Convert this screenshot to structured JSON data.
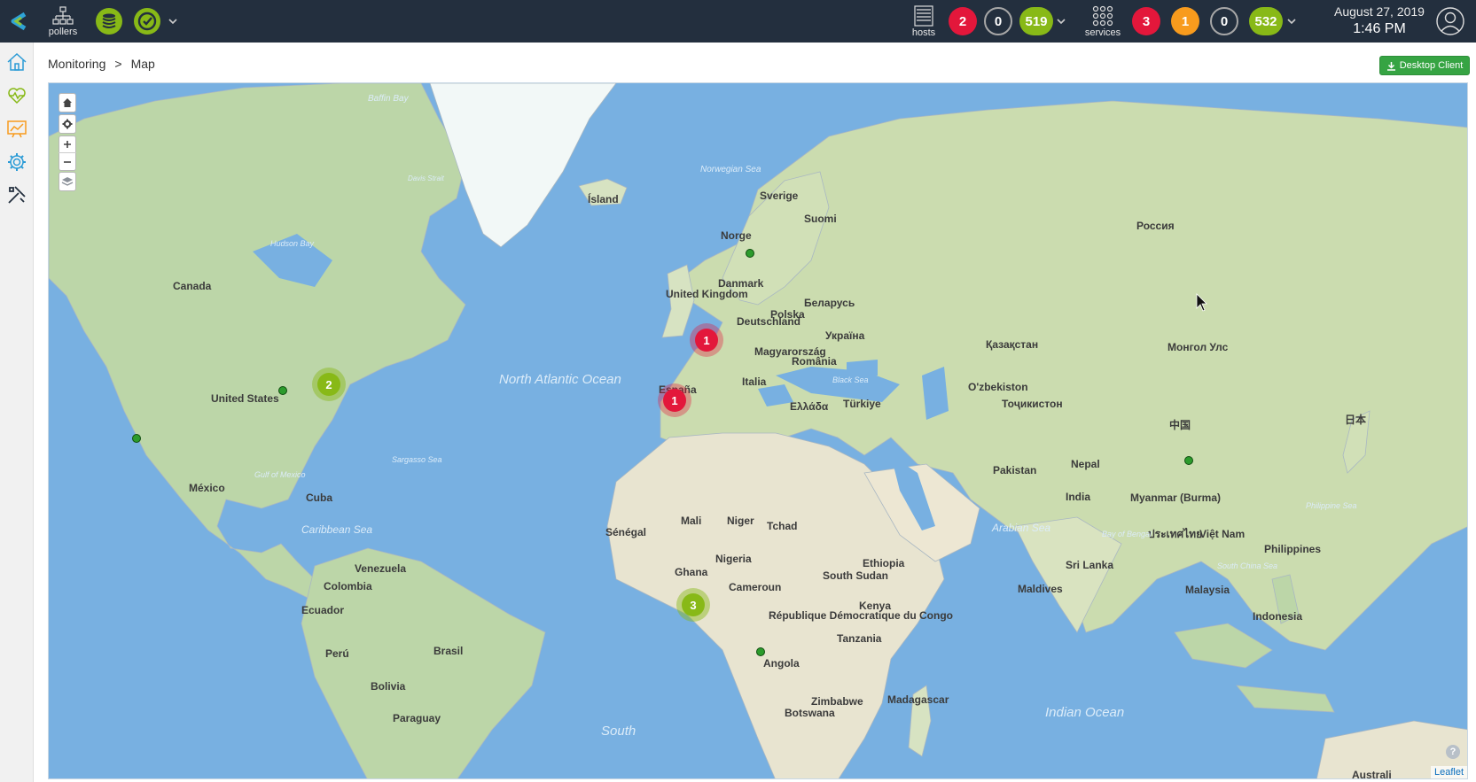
{
  "topbar": {
    "pollers_label": "pollers",
    "hosts_label": "hosts",
    "services_label": "services",
    "hosts_counts": {
      "down": "2",
      "unreachable": "0",
      "up": "519"
    },
    "services_counts": {
      "critical": "3",
      "warning": "1",
      "unknown": "0",
      "ok": "532"
    },
    "date": "August 27, 2019",
    "time": "1:46 PM"
  },
  "breadcrumb": {
    "section": "Monitoring",
    "separator": ">",
    "page": "Map"
  },
  "desktop_client_label": "Desktop Client",
  "map": {
    "attribution": "Leaflet",
    "help": "?",
    "clusters": [
      {
        "count": "1",
        "status": "critical"
      },
      {
        "count": "1",
        "status": "critical"
      },
      {
        "count": "2",
        "status": "ok"
      },
      {
        "count": "3",
        "status": "ok"
      }
    ],
    "labels": {
      "canada": "Canada",
      "united_states": "United States",
      "mexico": "México",
      "cuba": "Cuba",
      "venezuela": "Venezuela",
      "colombia": "Colombia",
      "ecuador": "Ecuador",
      "peru": "Perú",
      "brasil": "Brasil",
      "bolivia": "Bolivia",
      "paraguay": "Paraguay",
      "north_atlantic": "North Atlantic Ocean",
      "caribbean_sea": "Caribbean Sea",
      "gulf_of_mexico": "Gulf of Mexico",
      "sargasso_sea": "Sargasso Sea",
      "hudson_bay": "Hudson Bay",
      "island": "Ísland",
      "norge": "Norge",
      "sverige": "Sverige",
      "suomi": "Suomi",
      "united_kingdom": "United Kingdom",
      "danmark": "Danmark",
      "deutschland": "Deutschland",
      "polska": "Polska",
      "belarus": "Беларусь",
      "ukraina": "Україна",
      "magyarorszag": "Magyarország",
      "romania": "România",
      "italia": "Italia",
      "espana": "España",
      "ellada": "Ελλάδα",
      "turkiye": "Türkiye",
      "rossiya": "Россия",
      "kazakhstan": "Қазақстан",
      "mongol": "Монгол Улс",
      "uzbekiston": "O'zbekiston",
      "tojikiston": "Тоҷикистон",
      "pakistan": "Pakistan",
      "nepal": "Nepal",
      "india": "India",
      "myanmar": "Myanmar (Burma)",
      "china": "中国",
      "japan": "日本",
      "thailand": "ประเทศไทย",
      "vietnam": "Việt Nam",
      "philippines": "Philippines",
      "malaysia": "Malaysia",
      "indonesia": "Indonesia",
      "sri_lanka": "Sri Lanka",
      "maldives": "Maldives",
      "arabian_sea": "Arabian Sea",
      "bay_of_bengal": "Bay of Bengal",
      "indian_ocean": "Indian Ocean",
      "philippine_sea": "Philippine Sea",
      "south_china_sea": "South China Sea",
      "black_sea": "Black Sea",
      "norwegian_sea": "Norwegian Sea",
      "davis_strait": "Davis Strait",
      "baffin_bay": "Baffin Bay",
      "mali": "Mali",
      "niger": "Niger",
      "tchad": "Tchad",
      "senegal": "Sénégal",
      "ghana": "Ghana",
      "nigeria": "Nigeria",
      "cameroun": "Cameroun",
      "south_sudan": "South Sudan",
      "ethiopia": "Ethiopia",
      "kenya": "Kenya",
      "rdc": "République Démocratique du Congo",
      "tanzania": "Tanzania",
      "angola": "Angola",
      "zimbabwe": "Zimbabwe",
      "botswana": "Botswana",
      "madagascar": "Madagascar",
      "south": "South",
      "australia": "Australi"
    }
  },
  "colors": {
    "critical": "#e3173b",
    "warning": "#f89b1d",
    "ok": "#88b917",
    "topbar": "#232f3e",
    "water": "#78b0e1"
  }
}
